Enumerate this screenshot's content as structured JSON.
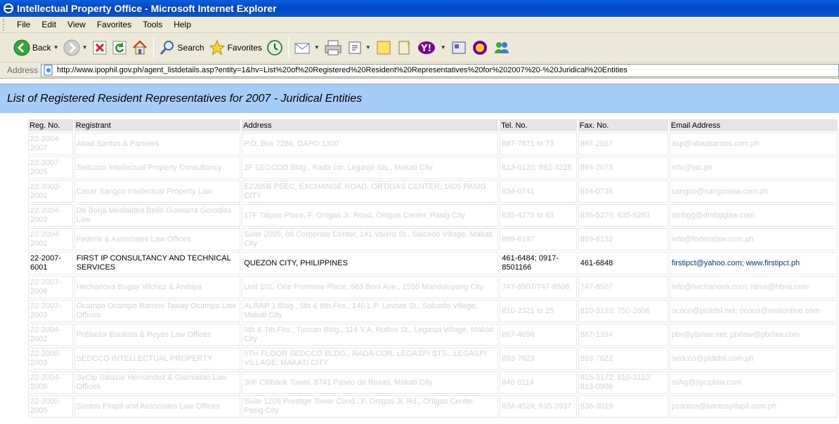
{
  "window": {
    "title": "Intellectual Property Office - Microsoft Internet Explorer"
  },
  "menu": [
    "File",
    "Edit",
    "View",
    "Favorites",
    "Tools",
    "Help"
  ],
  "toolbar": {
    "back_label": "Back",
    "search_label": "Search",
    "favorites_label": "Favorites"
  },
  "address": {
    "label": "Address",
    "url": "http://www.ipophil.gov.ph/agent_listdetails.asp?entity=1&hv=List%20of%20Registered%20Resident%20Representatives%20for%202007%20-%20Juridical%20Entities"
  },
  "page": {
    "title": "List of Registered Resident Representatives for 2007 - Juridical Entities",
    "columns": [
      "Reg. No.",
      "Registrant",
      "Address",
      "Tel. No.",
      "Fax. No.",
      "Email Address"
    ],
    "rows": [
      {
        "reg": "22-2004-2007",
        "registrant": "Abad Santos & Partners",
        "address": "P.O. Box 7286, DAPO 1300",
        "tel": "887-7871 to 73",
        "fax": "887-2557",
        "email": "asp@abadsantos.com.ph"
      },
      {
        "reg": "22-2007-2005",
        "registrant": "Sedcoco Intellectual Property Consultancy",
        "address": "2F SEDCCO Bldg., Rada cor. Legaspi Sts., Makati City",
        "tel": "813-0120; 892-3228",
        "fax": "894-2073",
        "email": "info@ipc.ph"
      },
      {
        "reg": "22-2002-2001",
        "registrant": "Cesar Sangco Intellectual Property Law",
        "address": "E2205B PSEC, EXCHANGE ROAD, ORTIGAS CENTER, 1605 PASIG CITY",
        "tel": "634-0741",
        "fax": "634-0736",
        "email": "sangco@sangcolaw.com.ph"
      },
      {
        "reg": "22-2004-2003",
        "registrant": "De Borja Medialdea Bello Guevarra Gerodias Law",
        "address": "17F Taipan Place, F. Ortigas Jr. Road, Ortigas Center, Pasig City",
        "tel": "635-4275 to 83",
        "fax": "635-5279; 635-5283",
        "email": "dmbgg@dmbgglaw.com"
      },
      {
        "reg": "22-2004-2001",
        "registrant": "Federis & Associates Law Offices",
        "address": "Suite 2005, 88 Corporate Center, 141 Valero St., Salcedo Village, Makati City",
        "tel": "889-6197",
        "fax": "889-6132",
        "email": "info@federislaw.com.ph"
      },
      {
        "reg": "22-2007-6001",
        "registrant": "FIRST IP CONSULTANCY AND TECHNICAL SERVICES",
        "address": "QUEZON CITY, PHILIPPINES",
        "tel": "461-6484; 0917-8501166",
        "fax": "461-6848",
        "email": "firstipct@yahoo.com; www.firstipct.ph"
      },
      {
        "reg": "22-2007-2006",
        "registrant": "Hechanova Bugay Vilchez & Andaya",
        "address": "Unit 101, One Primrose Place, 663 Boni Ave., 1550 Mandaluyong City",
        "tel": "747-8507/747-8508",
        "fax": "747-8507",
        "email": "info@hechanova.com; hbva@hbva.com"
      },
      {
        "reg": "22-2007-2003",
        "registrant": "Ocampo Ocampo Barreto Taway Ocampo Law Offices",
        "address": "ALRAP 1 Bldg., 5th & 6th Flrs., 140 L.P. Leviste St., Salcedo Village, Makati City",
        "tel": "810-2321 to 25",
        "fax": "810-3153; 750-2606",
        "email": "ococo@pldtdsl.net; ococo@mailonline.com"
      },
      {
        "reg": "22-2004-2002",
        "registrant": "Poblador Bautista & Reyes Law Offices",
        "address": "5th & 7th Flrs., Tuscan Bldg., 114 V.A. Rufino St., Legaspi Village, Makati City",
        "tel": "867-4696",
        "fax": "867-1394",
        "email": "pbr@pbrlaw.net; pbrlaw@pbrlaw.com"
      },
      {
        "reg": "22-2005-2003",
        "registrant": "SEDCCO INTELLECTUAL PROPERTY",
        "address": "5TH FLOOR SEDCCO BLDG., RADA COR. LEGASPI STS., LEGASPI VILLAGE, MAKATI CITY",
        "tel": "893-7623",
        "fax": "893-7622",
        "email": "sedcco@pldtdsl.com.ph"
      },
      {
        "reg": "22-2004-2008",
        "registrant": "SyCip Salazar Hernandez & Gatmaitan Law Offices",
        "address": "30F Citibank Tower, 8741 Paseo de Roxas, Makati City",
        "tel": "848-0114",
        "fax": "815-3172; 810-3110; 813-0906",
        "email": "sshg@syciplaw.com"
      },
      {
        "reg": "22-2005-2005",
        "registrant": "Santos Pilapil and Associates Law Offices",
        "address": "Suite 1209 Prestige Tower Cond., F. Ortigas Jr. Rd., Ortigas Center, Pasig City",
        "tel": "634-4524; 635-3937",
        "fax": "636-3019",
        "email": "psantos@santospilapil.com.ph"
      }
    ]
  }
}
